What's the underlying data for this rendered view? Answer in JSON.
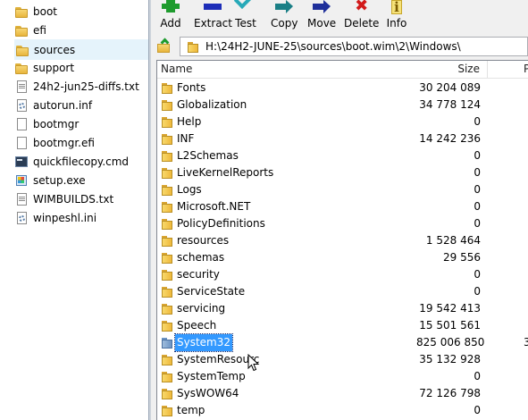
{
  "explorer": {
    "items": [
      {
        "label": "boot",
        "icon": "folder-icon",
        "selected": false
      },
      {
        "label": "efi",
        "icon": "folder-icon",
        "selected": false
      },
      {
        "label": "sources",
        "icon": "folder-icon",
        "selected": true
      },
      {
        "label": "support",
        "icon": "folder-icon",
        "selected": false
      },
      {
        "label": "24h2-jun25-diffs.txt",
        "icon": "text-file-icon",
        "selected": false
      },
      {
        "label": "autorun.inf",
        "icon": "settings-file-icon",
        "selected": false
      },
      {
        "label": "bootmgr",
        "icon": "file-icon",
        "selected": false
      },
      {
        "label": "bootmgr.efi",
        "icon": "file-icon",
        "selected": false
      },
      {
        "label": "quickfilecopy.cmd",
        "icon": "cmd-file-icon",
        "selected": false
      },
      {
        "label": "setup.exe",
        "icon": "exe-file-icon",
        "selected": false
      },
      {
        "label": "WIMBUILDS.txt",
        "icon": "text-file-icon",
        "selected": false
      },
      {
        "label": "winpeshl.ini",
        "icon": "settings-file-icon",
        "selected": false
      }
    ]
  },
  "toolbar": {
    "add": "Add",
    "extract": "Extract",
    "test": "Test",
    "copy": "Copy",
    "move": "Move",
    "delete": "Delete",
    "info": "Info"
  },
  "address": {
    "path": "H:\\24H2-JUNE-25\\sources\\boot.wim\\2\\Windows\\"
  },
  "list": {
    "columns": {
      "name": "Name",
      "size": "Size",
      "packed": "P"
    },
    "rows": [
      {
        "name": "Fonts",
        "size": "30 204 089",
        "packed": ""
      },
      {
        "name": "Globalization",
        "size": "34 778 124",
        "packed": ""
      },
      {
        "name": "Help",
        "size": "0",
        "packed": ""
      },
      {
        "name": "INF",
        "size": "14 242 236",
        "packed": ""
      },
      {
        "name": "L2Schemas",
        "size": "0",
        "packed": ""
      },
      {
        "name": "LiveKernelReports",
        "size": "0",
        "packed": ""
      },
      {
        "name": "Logs",
        "size": "0",
        "packed": ""
      },
      {
        "name": "Microsoft.NET",
        "size": "0",
        "packed": ""
      },
      {
        "name": "PolicyDefinitions",
        "size": "0",
        "packed": ""
      },
      {
        "name": "resources",
        "size": "1 528 464",
        "packed": ""
      },
      {
        "name": "schemas",
        "size": "29 556",
        "packed": ""
      },
      {
        "name": "security",
        "size": "0",
        "packed": ""
      },
      {
        "name": "ServiceState",
        "size": "0",
        "packed": ""
      },
      {
        "name": "servicing",
        "size": "19 542 413",
        "packed": ""
      },
      {
        "name": "Speech",
        "size": "15 501 561",
        "packed": ""
      },
      {
        "name": "System32",
        "size": "825 006 850",
        "packed": "3",
        "selected": true
      },
      {
        "name": "SystemResourc",
        "size": "35 132 928",
        "packed": ""
      },
      {
        "name": "SystemTemp",
        "size": "0",
        "packed": ""
      },
      {
        "name": "SysWOW64",
        "size": "72 126 798",
        "packed": ""
      },
      {
        "name": "temp",
        "size": "0",
        "packed": ""
      }
    ]
  },
  "colors": {
    "selection": "#3399ff",
    "explorer_selection": "#e5f3fb",
    "add_icon": "#1f9b2e",
    "extract_icon": "#1d2db8",
    "delete_icon": "#d21a1a"
  }
}
